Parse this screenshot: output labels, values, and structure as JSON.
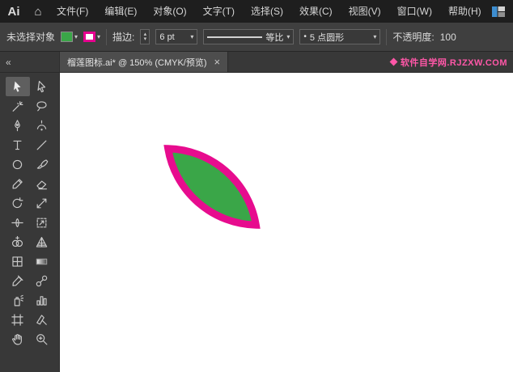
{
  "app": {
    "logo": "Ai",
    "home_glyph": "⌂"
  },
  "menubar": {
    "items": [
      "文件(F)",
      "编辑(E)",
      "对象(O)",
      "文字(T)",
      "选择(S)",
      "效果(C)",
      "视图(V)",
      "窗口(W)",
      "帮助(H)"
    ]
  },
  "control_bar": {
    "selection_status": "未选择对象",
    "fill_color": "#3aa648",
    "stroke_color": "#e6008f",
    "stroke_label": "描边:",
    "stepper_up": "▴",
    "stepper_down": "▾",
    "dropdown_arrow": "▾",
    "stroke_weight": "6 pt",
    "width_profile": "等比",
    "brush_bullet": "•",
    "brush_definition": "5 点圆形",
    "opacity_label": "不透明度:",
    "opacity_value": "100"
  },
  "tabbar": {
    "collapse_glyph": "«",
    "tab_title": "榴莲图标.ai* @ 150% (CMYK/预览)",
    "close_glyph": "×",
    "watermark_text": "软件自学网.RJZXW.COM",
    "watermark_color": "#ff57a8"
  },
  "toolbar": {
    "tools": [
      {
        "name": "selection",
        "active": true
      },
      {
        "name": "direct-selection",
        "active": false
      },
      {
        "name": "magic-wand",
        "active": false
      },
      {
        "name": "lasso",
        "active": false
      },
      {
        "name": "pen",
        "active": false
      },
      {
        "name": "curvature",
        "active": false
      },
      {
        "name": "type",
        "active": false
      },
      {
        "name": "line-segment",
        "active": false
      },
      {
        "name": "ellipse",
        "active": false
      },
      {
        "name": "paintbrush",
        "active": false
      },
      {
        "name": "pencil",
        "active": false
      },
      {
        "name": "eraser",
        "active": false
      },
      {
        "name": "rotate",
        "active": false
      },
      {
        "name": "scale",
        "active": false
      },
      {
        "name": "width",
        "active": false
      },
      {
        "name": "free-transform",
        "active": false
      },
      {
        "name": "shape-builder",
        "active": false
      },
      {
        "name": "perspective-grid",
        "active": false
      },
      {
        "name": "mesh",
        "active": false
      },
      {
        "name": "gradient",
        "active": false
      },
      {
        "name": "eyedropper",
        "active": false
      },
      {
        "name": "blend",
        "active": false
      },
      {
        "name": "symbol-sprayer",
        "active": false
      },
      {
        "name": "column-graph",
        "active": false
      },
      {
        "name": "artboard",
        "active": false
      },
      {
        "name": "slice",
        "active": false
      },
      {
        "name": "hand",
        "active": false
      },
      {
        "name": "zoom",
        "active": false
      }
    ]
  },
  "canvas": {
    "leaf": {
      "fill": "#3aa648",
      "stroke": "#e70c8e",
      "stroke_px": "9"
    }
  }
}
